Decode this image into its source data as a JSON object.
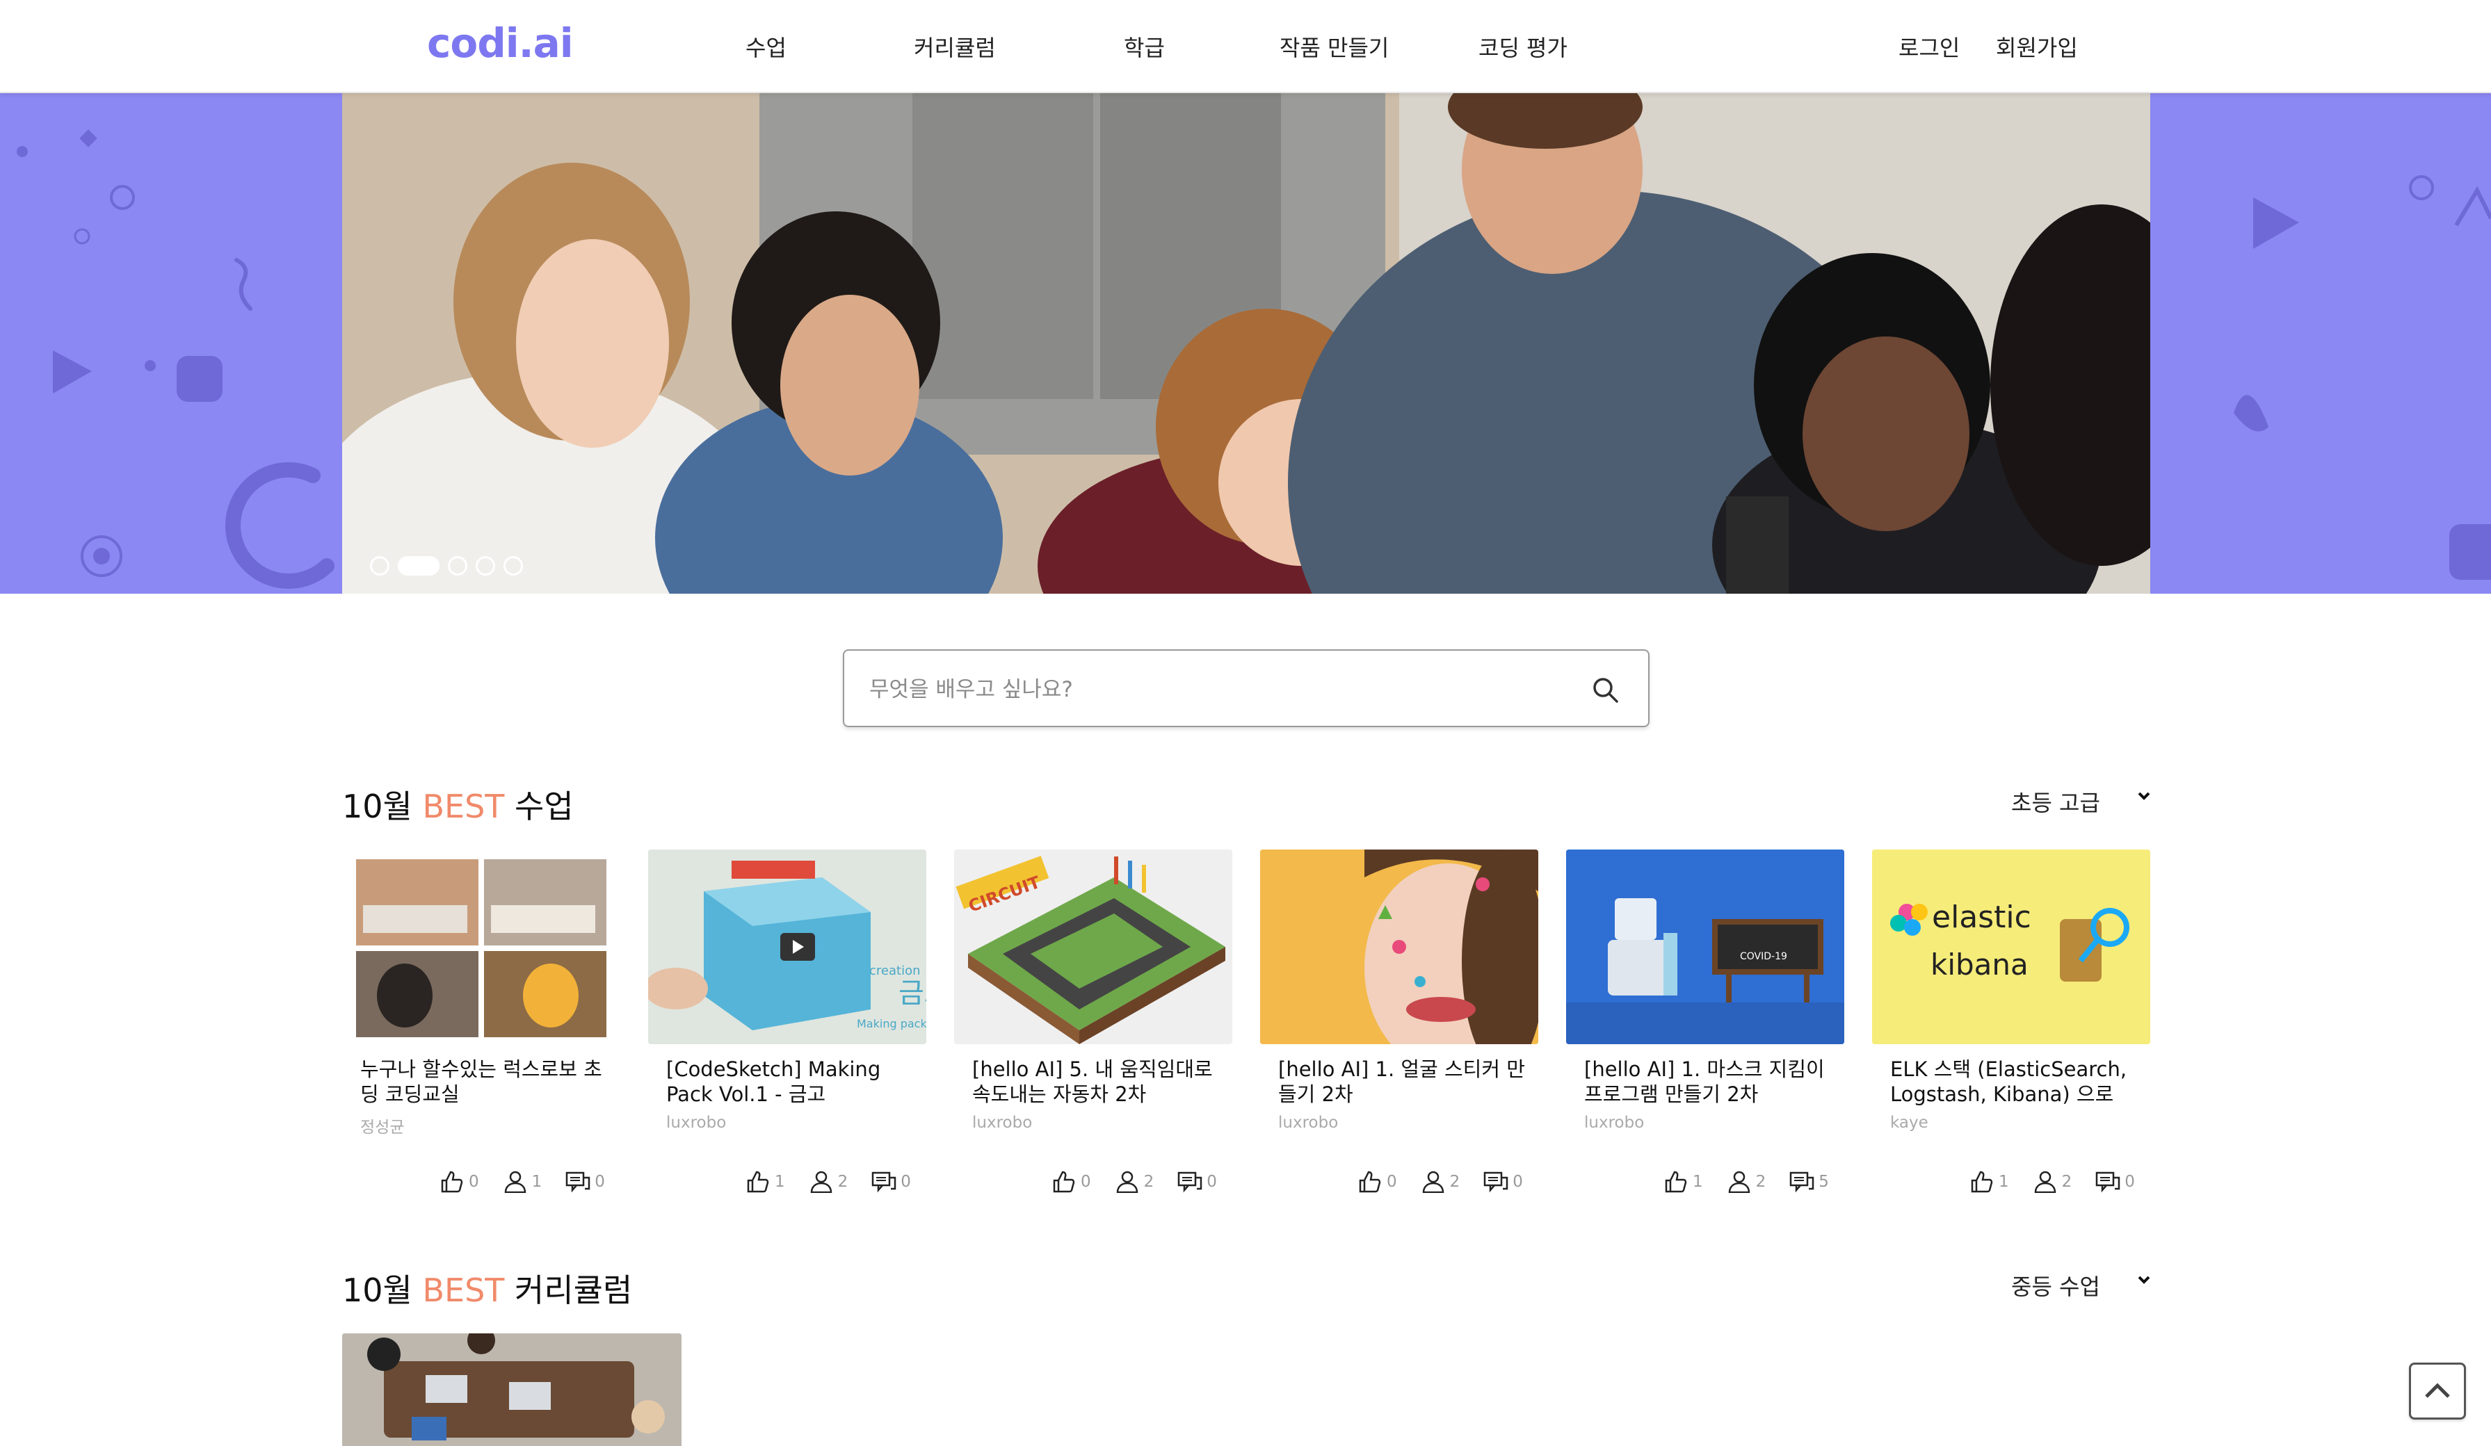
{
  "header": {
    "logo": "codi.ai",
    "nav": [
      "수업",
      "커리큘럼",
      "학급",
      "작품 만들기",
      "코딩 평가"
    ],
    "login": "로그인",
    "signup": "회원가입"
  },
  "hero": {
    "slide_count": 5,
    "active_slide": 2
  },
  "search": {
    "placeholder": "무엇을 배우고 싶나요?",
    "value": ""
  },
  "best_classes": {
    "title_month": "10월",
    "title_best": "BEST",
    "title_rest": "수업",
    "filter": "초등 고급",
    "cards": [
      {
        "title": "누구나 할수있는 럭스로보 초딩 코딩교실",
        "author": "정성균",
        "likes": "0",
        "students": "1",
        "comments": "0"
      },
      {
        "title": "[CodeSketch] Making Pack Vol.1 - 금고",
        "author": "luxrobo",
        "likes": "1",
        "students": "2",
        "comments": "0"
      },
      {
        "title": "[hello AI] 5. 내 움직임대로 속도내는 자동차 2차",
        "author": "luxrobo",
        "likes": "0",
        "students": "2",
        "comments": "0"
      },
      {
        "title": "[hello AI] 1. 얼굴 스티커 만들기 2차",
        "author": "luxrobo",
        "likes": "0",
        "students": "2",
        "comments": "0"
      },
      {
        "title": "[hello AI] 1. 마스크 지킴이 프로그램 만들기 2차",
        "author": "luxrobo",
        "likes": "1",
        "students": "2",
        "comments": "5"
      },
      {
        "title": "ELK 스택 (ElasticSearch, Logstash, Kibana) 으로",
        "author": "kaye",
        "likes": "1",
        "students": "2",
        "comments": "0"
      }
    ],
    "thumb_texts": {
      "circuit": "CIRCUIT",
      "making_pack": "Making pack",
      "vault": "금고",
      "creation": "creation",
      "covid": "COVID-19",
      "elastic": "elastic",
      "kibana": "kibana"
    }
  },
  "best_curriculum": {
    "title_month": "10월",
    "title_best": "BEST",
    "title_rest": "커리큘럼",
    "filter": "중등 수업"
  },
  "colors": {
    "brand": "#7d78f0",
    "hero_bg": "#8b87f3",
    "best_accent": "#f08a6a"
  },
  "icons": [
    "search-icon",
    "chevron-down-icon",
    "thumbs-up-icon",
    "user-icon",
    "comment-icon",
    "arrow-up-icon"
  ]
}
